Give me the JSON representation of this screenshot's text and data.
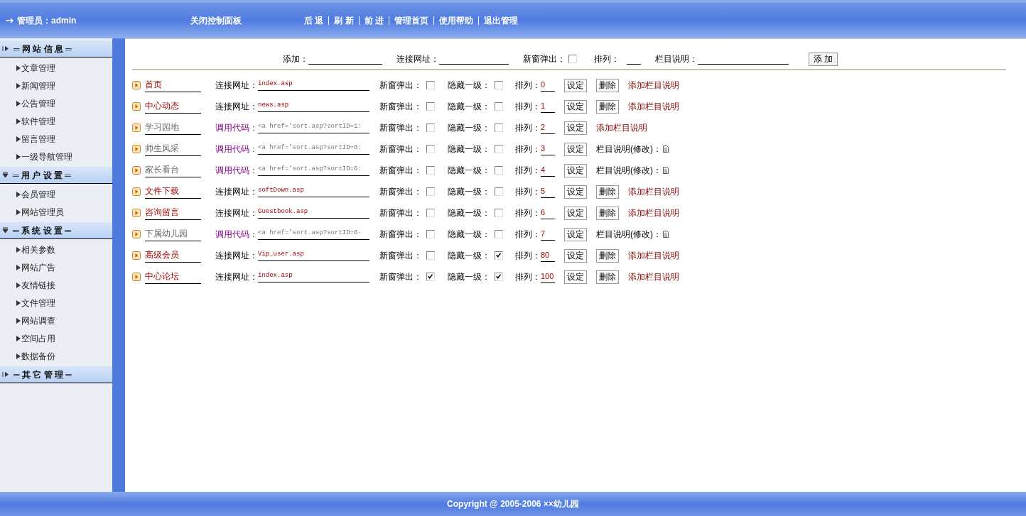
{
  "top_bar": {
    "admin_label": "管理员：admin",
    "close_panel": "关闭控制面板",
    "nav_links": [
      "后 退",
      "刷 新",
      "前 进",
      "管理首页",
      "使用帮助",
      "退出管理"
    ]
  },
  "sidebar": {
    "sections": [
      {
        "title": "═ 网 站 信 息 ═",
        "kind": "right",
        "items": [
          "文章管理",
          "新闻管理",
          "公告管理",
          "软件管理",
          "留言管理",
          "一级导航管理"
        ]
      },
      {
        "title": "═ 用 户 设 置 ═",
        "kind": "down",
        "items": [
          "会员管理",
          "网站管理员"
        ]
      },
      {
        "title": "═ 系 统 设 置 ═",
        "kind": "down",
        "items": [
          "相关参数",
          "网站广告",
          "友情链接",
          "文件管理",
          "网站调查",
          "空间占用",
          "数据备份"
        ]
      },
      {
        "title": "═ 其 它 管 理 ═",
        "kind": "right"
      }
    ]
  },
  "add_form": {
    "add_label": "添加：",
    "url_label": "连接网址：",
    "new_window_label": "新窗弹出：",
    "new_window": false,
    "order_label": "排列：",
    "note_label": "栏目说明：",
    "add_button": "添 加"
  },
  "rows": [
    {
      "kind": "link",
      "name": "首页",
      "field_label": "连接网址：",
      "value": "index.asp",
      "new_window_label": "新窗弹出：",
      "new_window": false,
      "hide_label": "隐藏一级：",
      "hide": false,
      "order_label": "排列：",
      "order": "0",
      "set_button": "设定",
      "delete_button": "删除",
      "note": "添加栏目说明",
      "note_icon": false
    },
    {
      "kind": "link",
      "name": "中心动态",
      "field_label": "连接网址：",
      "value": "news.asp",
      "new_window_label": "新窗弹出：",
      "new_window": false,
      "hide_label": "隐藏一级：",
      "hide": false,
      "order_label": "排列：",
      "order": "1",
      "set_button": "设定",
      "delete_button": "删除",
      "note": "添加栏目说明",
      "note_icon": false
    },
    {
      "kind": "code",
      "name": "学习园地",
      "field_label": "调用代码：",
      "value": "<a href='sort.asp?sortID=1:",
      "new_window_label": "新窗弹出：",
      "new_window": false,
      "hide_label": "隐藏一级：",
      "hide": false,
      "order_label": "排列：",
      "order": "2",
      "set_button": "设定",
      "note": "添加栏目说明",
      "note_icon": false
    },
    {
      "kind": "code",
      "name": "师生风采",
      "field_label": "调用代码：",
      "value": "<a href='sort.asp?sortID=6:",
      "new_window_label": "新窗弹出：",
      "new_window": false,
      "hide_label": "隐藏一级：",
      "hide": false,
      "order_label": "排列：",
      "order": "3",
      "set_button": "设定",
      "note": "栏目说明(修改)：",
      "note_icon": true
    },
    {
      "kind": "code",
      "name": "家长看台",
      "field_label": "调用代码：",
      "value": "<a href='sort.asp?sortID=6:",
      "new_window_label": "新窗弹出：",
      "new_window": false,
      "hide_label": "隐藏一级：",
      "hide": false,
      "order_label": "排列：",
      "order": "4",
      "set_button": "设定",
      "note": "栏目说明(修改)：",
      "note_icon": true
    },
    {
      "kind": "link",
      "name": "文件下载",
      "field_label": "连接网址：",
      "value": "softDown.asp",
      "new_window_label": "新窗弹出：",
      "new_window": false,
      "hide_label": "隐藏一级：",
      "hide": false,
      "order_label": "排列：",
      "order": "5",
      "set_button": "设定",
      "delete_button": "删除",
      "note": "添加栏目说明",
      "note_icon": false
    },
    {
      "kind": "link",
      "name": "咨询留言",
      "field_label": "连接网址：",
      "value": "Guestbook.asp",
      "new_window_label": "新窗弹出：",
      "new_window": false,
      "hide_label": "隐藏一级：",
      "hide": false,
      "order_label": "排列：",
      "order": "6",
      "set_button": "设定",
      "delete_button": "删除",
      "note": "添加栏目说明",
      "note_icon": false
    },
    {
      "kind": "code",
      "name": "下属幼儿园",
      "field_label": "调用代码：",
      "value": "<a href='sort.asp?sortID=6·",
      "new_window_label": "新窗弹出：",
      "new_window": false,
      "hide_label": "隐藏一级：",
      "hide": false,
      "order_label": "排列：",
      "order": "7",
      "set_button": "设定",
      "note": "栏目说明(修改)：",
      "note_icon": true
    },
    {
      "kind": "link",
      "name": "高级会员",
      "field_label": "连接网址：",
      "value": "Vip_user.asp",
      "new_window_label": "新窗弹出：",
      "new_window": false,
      "hide_label": "隐藏一级：",
      "hide": true,
      "order_label": "排列：",
      "order": "80",
      "set_button": "设定",
      "delete_button": "删除",
      "note": "添加栏目说明",
      "note_icon": false
    },
    {
      "kind": "link",
      "name": "中心论坛",
      "field_label": "连接网址：",
      "value": "index.asp",
      "new_window_label": "新窗弹出：",
      "new_window": true,
      "hide_label": "隐藏一级：",
      "hide": true,
      "order_label": "排列：",
      "order": "100",
      "set_button": "设定",
      "delete_button": "删除",
      "note": "添加栏目说明",
      "note_icon": false
    }
  ],
  "footer": {
    "copyright": "Copyright @ 2005-2006 ××幼儿园"
  }
}
